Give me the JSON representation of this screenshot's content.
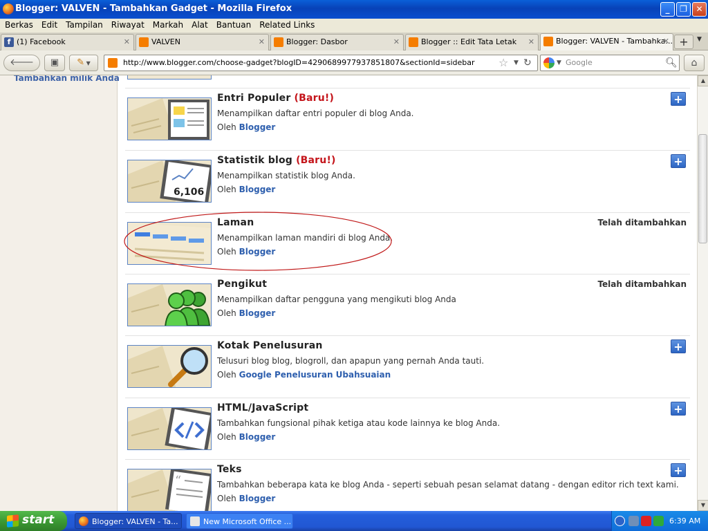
{
  "window": {
    "title": "Blogger: VALVEN - Tambahkan Gadget - Mozilla Firefox"
  },
  "window_buttons": {
    "minimize": "_",
    "restore": "❐",
    "close": "✕"
  },
  "menu": [
    "Berkas",
    "Edit",
    "Tampilan",
    "Riwayat",
    "Markah",
    "Alat",
    "Bantuan",
    "Related Links"
  ],
  "tabs": [
    {
      "label": "(1) Facebook",
      "icon": "facebook-icon"
    },
    {
      "label": "VALVEN",
      "icon": "blogger-icon"
    },
    {
      "label": "Blogger: Dasbor",
      "icon": "blogger-icon"
    },
    {
      "label": "Blogger :: Edit Tata Letak",
      "icon": "blogger-icon"
    },
    {
      "label": "Blogger: VALVEN - Tambahka...",
      "icon": "blogger-icon",
      "active": true
    }
  ],
  "nav": {
    "url": "http://www.blogger.com/choose-gadget?blogID=4290689977937851807&sectionId=sidebar",
    "search_placeholder": "Google"
  },
  "sidebar": {
    "add_own": "Tambahkan milik Anda"
  },
  "gadgets": [
    {
      "title": "Entri Populer",
      "badge": "(Baru!)",
      "desc": "Menampilkan daftar entri populer di blog Anda.",
      "by": "Oleh",
      "author": "Blogger",
      "status": "add"
    },
    {
      "title": "Statistik blog",
      "badge": "(Baru!)",
      "desc": "Menampilkan statistik blog Anda.",
      "by": "Oleh",
      "author": "Blogger",
      "status": "add",
      "thumb_text": "6,106"
    },
    {
      "title": "Laman",
      "badge": "",
      "desc": "Menampilkan laman mandiri di blog Anda.",
      "by": "Oleh",
      "author": "Blogger",
      "status": "Telah ditambahkan"
    },
    {
      "title": "Pengikut",
      "badge": "",
      "desc": "Menampilkan daftar pengguna yang mengikuti blog Anda",
      "by": "Oleh",
      "author": "Blogger",
      "status": "Telah ditambahkan"
    },
    {
      "title": "Kotak Penelusuran",
      "badge": "",
      "desc": "Telusuri blog blog, blogroll, dan apapun yang pernah Anda tauti.",
      "by": "Oleh",
      "author": "Google Penelusuran Ubahsuaian",
      "status": "add"
    },
    {
      "title": "HTML/JavaScript",
      "badge": "",
      "desc": "Tambahkan fungsional pihak ketiga atau kode lainnya ke blog Anda.",
      "by": "Oleh",
      "author": "Blogger",
      "status": "add"
    },
    {
      "title": "Teks",
      "badge": "",
      "desc": "Tambahkan beberapa kata ke blog Anda - seperti sebuah pesan selamat datang - dengan editor rich text kami.",
      "by": "Oleh",
      "author": "Blogger",
      "status": "add"
    }
  ],
  "add_label": "+",
  "taskbar": {
    "start": "start",
    "tasks": [
      "Blogger: VALVEN - Ta...",
      "New Microsoft Office ..."
    ],
    "clock": "6:39 AM"
  },
  "colors": {
    "accent": "#2e5fae",
    "new_badge": "#c4141a",
    "annotation": "#c01818"
  }
}
